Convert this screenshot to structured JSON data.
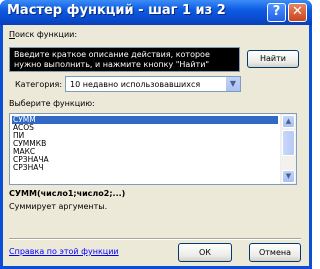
{
  "window": {
    "title": "Мастер функций - шаг 1 из 2",
    "help_glyph": "?",
    "close_glyph": "✕"
  },
  "search": {
    "label": "Поиск функции:",
    "text": "Введите краткое описание действия, которое нужно выполнить, и нажмите кнопку \"Найти\"",
    "find_button": "Найти"
  },
  "category": {
    "label": "Категория:",
    "value": "10 недавно использовавшихся",
    "arrow": "▼"
  },
  "functions": {
    "label": "Выберите функцию:",
    "items": [
      "СУММ",
      "ACOS",
      "ПИ",
      "СУММКВ",
      "МАКС",
      "СРЗНАЧА",
      "СРЗНАЧ"
    ],
    "selected": "СУММ",
    "scroll_up": "▲",
    "scroll_down": "▼"
  },
  "details": {
    "signature": "СУММ(число1;число2;...)",
    "description": "Суммирует аргументы."
  },
  "footer": {
    "help_link": "Справка по этой функции",
    "ok": "ОК",
    "cancel": "Отмена"
  }
}
